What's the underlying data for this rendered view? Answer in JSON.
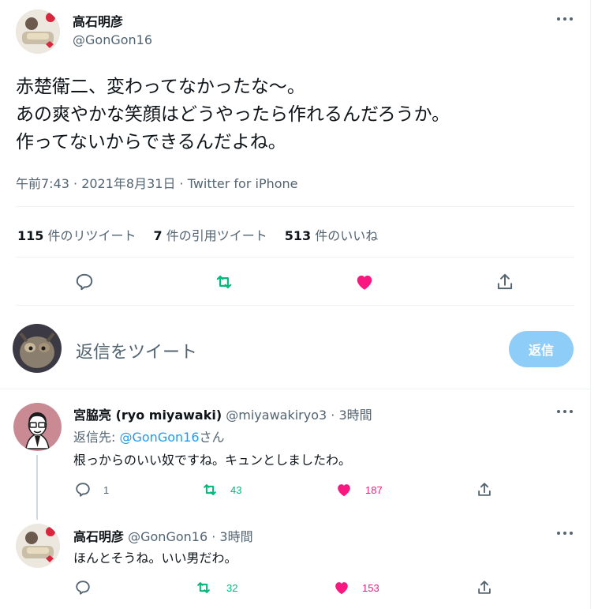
{
  "main_tweet": {
    "author_name": "高石明彦",
    "author_handle": "@GonGon16",
    "text_lines": [
      "赤楚衛二、変わってなかったな〜。",
      "あの爽やかな笑顔はどうやったら作れるんだろうか。",
      "作ってないからできるんだよね。"
    ],
    "meta": "午前7:43 · 2021年8月31日 · Twitter for iPhone",
    "stats": {
      "retweets_num": "115",
      "retweets_label": " 件のリツイート",
      "quotes_num": "7",
      "quotes_label": " 件の引用ツイート",
      "likes_num": "513",
      "likes_label": " 件のいいね"
    }
  },
  "reply_box": {
    "placeholder": "返信をツイート",
    "button_label": "返信"
  },
  "replies": [
    {
      "author_name": "宮脇亮 (ryo miyawaki)",
      "author_handle": "@miyawakiryo3",
      "time": " · 3時間",
      "reply_to_prefix": "返信先: ",
      "reply_to_handle": "@GonGon16",
      "reply_to_suffix": "さん",
      "text": "根っからのいい奴ですね。キュンとしましたわ。",
      "reply_count": "1",
      "retweet_count": "43",
      "like_count": "187"
    },
    {
      "author_name": "高石明彦",
      "author_handle": "@GonGon16",
      "time": " · 3時間",
      "text": "ほんとそうね。いい男だわ。",
      "reply_count": "",
      "retweet_count": "32",
      "like_count": "153"
    }
  ],
  "colors": {
    "accent": "#1d9bf0",
    "retweet_green": "#00ba7c",
    "like_pink": "#f91880",
    "muted": "#536471",
    "reply_button_bg": "#8ecdf8"
  },
  "icons": [
    "reply-icon",
    "retweet-icon",
    "like-icon",
    "share-icon",
    "more-icon"
  ]
}
